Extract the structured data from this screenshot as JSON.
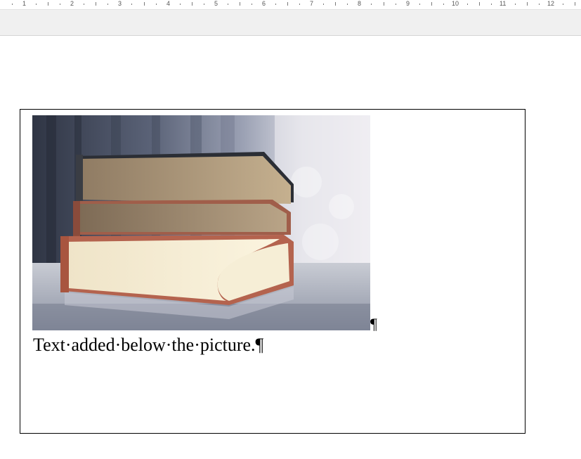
{
  "ruler": {
    "numbers": [
      "1",
      "2",
      "3",
      "4",
      "5",
      "6",
      "7",
      "8",
      "9",
      "10",
      "11",
      "12"
    ]
  },
  "document": {
    "picture_alt": "stack of three books",
    "pilcrow_after_picture": "¶",
    "paragraph_text": "Text·added·below·the·picture.¶"
  },
  "colors": {
    "toolband": "#f0f0f0",
    "frame_border": "#000000",
    "text": "#000000"
  }
}
